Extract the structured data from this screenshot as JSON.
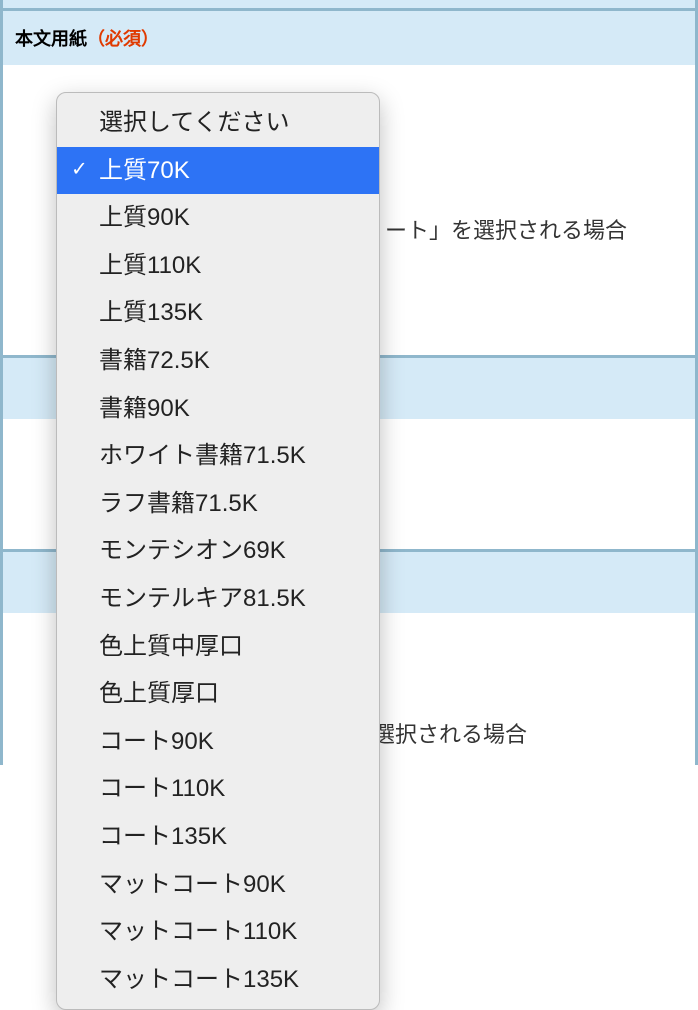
{
  "section1": {
    "label": "本文用紙",
    "required": "（必須）",
    "note": "ート」を選択される場合"
  },
  "section2": {
    "note": "※「カラー」、「カラー混在」を選択される場合"
  },
  "dropdown": {
    "placeholder": "選択してください",
    "options": [
      "選択してください",
      "上質70K",
      "上質90K",
      "上質110K",
      "上質135K",
      "書籍72.5K",
      "書籍90K",
      "ホワイト書籍71.5K",
      "ラフ書籍71.5K",
      "モンテシオン69K",
      "モンテルキア81.5K",
      "色上質中厚口",
      "色上質厚口",
      "コート90K",
      "コート110K",
      "コート135K",
      "マットコート90K",
      "マットコート110K",
      "マットコート135K"
    ],
    "selectedIndex": 1
  }
}
